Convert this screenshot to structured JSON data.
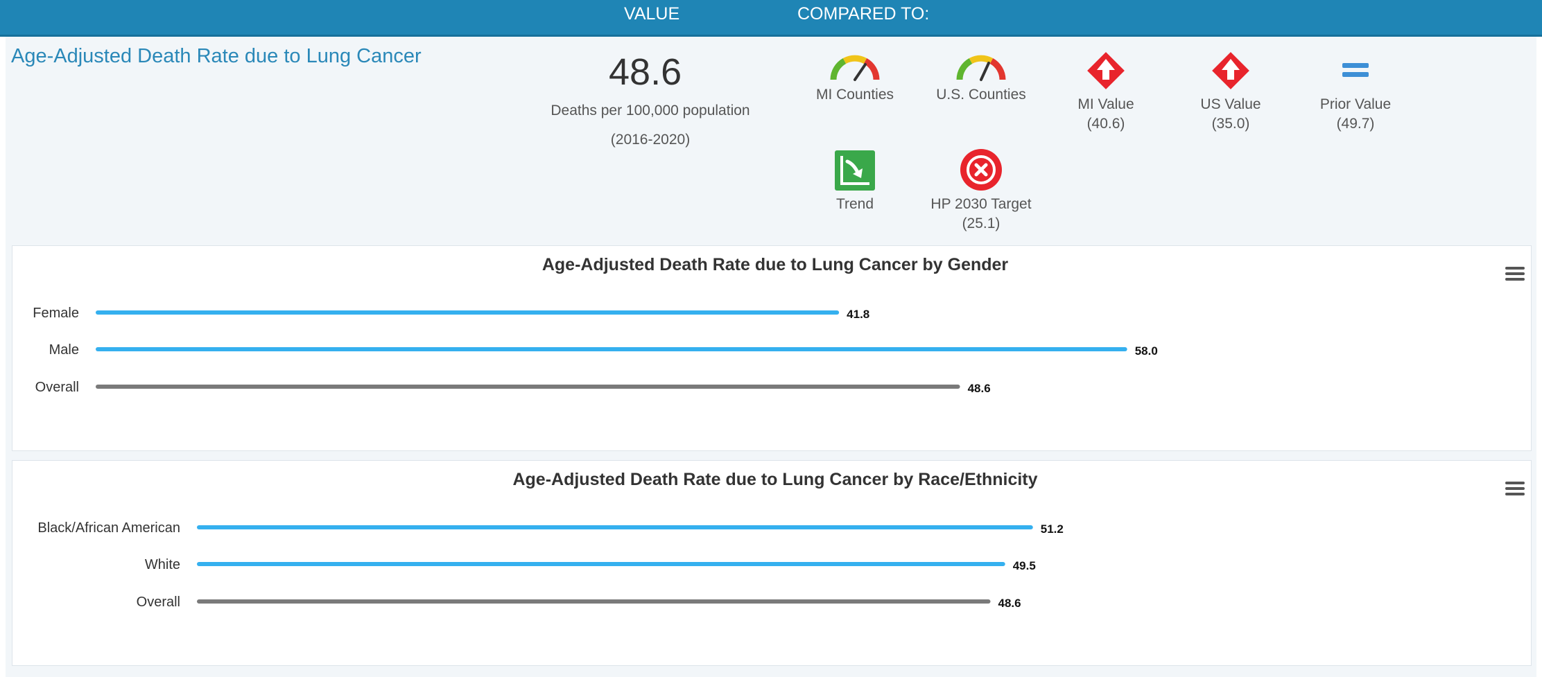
{
  "header": {
    "value_label": "VALUE",
    "compared_label": "COMPARED TO:"
  },
  "indicator": {
    "title": "Age-Adjusted Death Rate due to Lung Cancer",
    "value": "48.6",
    "unit": "Deaths per 100,000 population",
    "period": "(2016-2020)"
  },
  "comparisons": [
    {
      "label": "MI Counties",
      "sub": "",
      "icon": "gauge-icon"
    },
    {
      "label": "U.S. Counties",
      "sub": "",
      "icon": "gauge-icon"
    },
    {
      "label": "MI Value",
      "sub": "(40.6)",
      "icon": "red-up-arrow-icon"
    },
    {
      "label": "US Value",
      "sub": "(35.0)",
      "icon": "red-up-arrow-icon"
    },
    {
      "label": "Prior Value",
      "sub": "(49.7)",
      "icon": "equal-icon"
    },
    {
      "label": "Trend",
      "sub": "",
      "icon": "green-down-trend-icon"
    },
    {
      "label": "HP 2030 Target",
      "sub": "(25.1)",
      "icon": "red-x-circle-icon"
    }
  ],
  "colors": {
    "header": "#1f85b5",
    "bar": "#35b0ef",
    "overall": "#7a7a7a",
    "title": "#2a88b8"
  },
  "chart_data": [
    {
      "type": "bar",
      "orientation": "horizontal",
      "title": "Age-Adjusted Death Rate due to Lung Cancer by Gender",
      "categories": [
        "Female",
        "Male",
        "Overall"
      ],
      "values": [
        41.8,
        58.0,
        48.6
      ],
      "value_labels": [
        "41.8",
        "58.0",
        "48.6"
      ],
      "xlim": [
        0,
        80
      ],
      "grid": false
    },
    {
      "type": "bar",
      "orientation": "horizontal",
      "title": "Age-Adjusted Death Rate due to Lung Cancer by Race/Ethnicity",
      "categories": [
        "Black/African American",
        "White",
        "Overall"
      ],
      "values": [
        51.2,
        49.5,
        48.6
      ],
      "value_labels": [
        "51.2",
        "49.5",
        "48.6"
      ],
      "xlim": [
        0,
        80
      ],
      "grid": false
    }
  ]
}
